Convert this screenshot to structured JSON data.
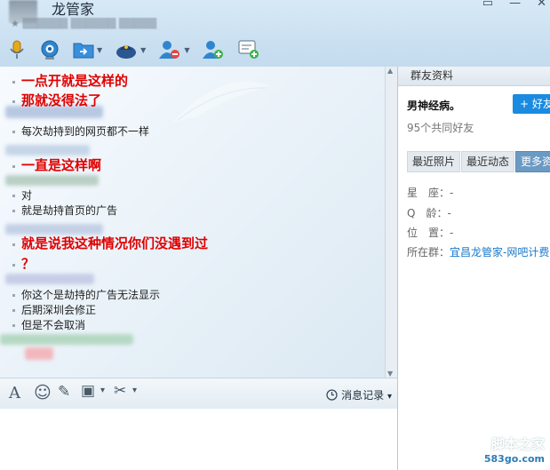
{
  "window": {
    "title": "龙管家",
    "controls": [
      "▭",
      "—",
      "✕"
    ]
  },
  "toolbar": {
    "items": [
      {
        "icon": "microphone-icon"
      },
      {
        "icon": "video-camera-icon"
      },
      {
        "icon": "file-transfer-icon",
        "arrow": "▼"
      },
      {
        "icon": "remote-assist-icon",
        "arrow": "▼"
      },
      {
        "icon": "remove-member-icon",
        "arrow": "▼"
      },
      {
        "icon": "add-member-icon"
      },
      {
        "icon": "add-chat-icon"
      }
    ]
  },
  "chat": {
    "messages": [
      {
        "style": "red",
        "text": "一点开就是这样的"
      },
      {
        "style": "red",
        "text": "那就没得法了"
      },
      {
        "style": "black",
        "text": "每次劫持到的网页都不一样"
      },
      {
        "style": "red",
        "text": "一直是这样啊"
      },
      {
        "style": "black",
        "text": "对"
      },
      {
        "style": "black",
        "text": "就是劫持首页的广告"
      },
      {
        "style": "red",
        "text": "就是说我这种情况你们没遇到过"
      },
      {
        "style": "red",
        "text": "？"
      },
      {
        "style": "black",
        "text": "你这个是劫持的广告无法显示"
      },
      {
        "style": "black",
        "text": "后期深圳会修正"
      },
      {
        "style": "black",
        "text": "但是不会取消"
      }
    ],
    "scroll_up": "▲",
    "scroll_down": "▼"
  },
  "inputbar": {
    "tools": [
      {
        "icon": "font-icon",
        "glyph": "A"
      },
      {
        "icon": "emoji-icon",
        "glyph": "☺"
      },
      {
        "icon": "edit-icon",
        "glyph": "✎"
      },
      {
        "icon": "image-icon",
        "glyph": "▣",
        "arrow": "▾"
      },
      {
        "icon": "scissors-icon",
        "glyph": "✂",
        "arrow": "▾"
      }
    ],
    "history_label": "消息记录",
    "history_arrow": "▾"
  },
  "panel": {
    "header": "群友资料",
    "nickname": "男神经病。",
    "add_button": "+ 好友",
    "mutual_friends": "95个共同好友",
    "tabs": [
      {
        "label": "最近照片",
        "active": false
      },
      {
        "label": "最近动态",
        "active": false
      },
      {
        "label": "更多资料",
        "active": true
      }
    ],
    "info": [
      {
        "label": "星　座：",
        "value": "-"
      },
      {
        "label": "Q　龄：",
        "value": "-"
      },
      {
        "label": "位　置：",
        "value": "-"
      }
    ],
    "group_label": "所在群：",
    "group_name": "宜昌龙管家-网吧计费"
  },
  "watermark": {
    "text": "脚本之家",
    "url": "583go.com"
  },
  "colors": {
    "red_text": "#e00000",
    "accent_blue": "#1a8be0",
    "active_tab": "#6b9ac3"
  }
}
